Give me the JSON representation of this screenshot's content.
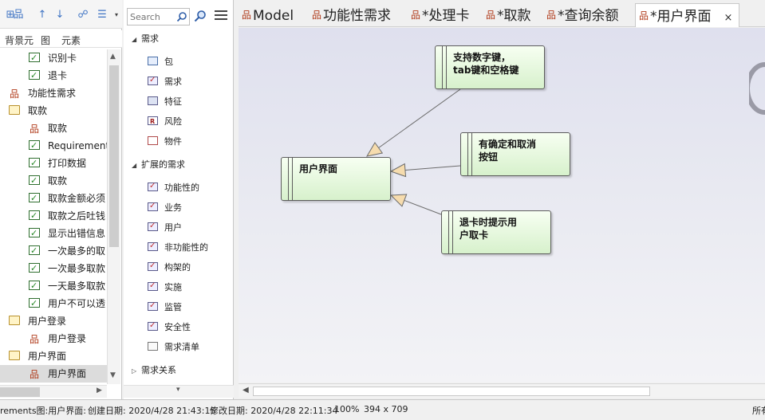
{
  "left_panel": {
    "tabs": [
      "背景元",
      "图",
      "元素"
    ],
    "tree": [
      {
        "label": "识别卡",
        "icon": "requirement-check-icon",
        "indent": 2
      },
      {
        "label": "退卡",
        "icon": "requirement-check-icon",
        "indent": 2
      },
      {
        "label": "功能性需求",
        "icon": "diagram-icon",
        "indent": 1
      },
      {
        "label": "取款",
        "icon": "folder-icon",
        "indent": 1
      },
      {
        "label": "取款",
        "icon": "diagram-icon",
        "indent": 2
      },
      {
        "label": "Requirement",
        "icon": "requirement-check-icon",
        "indent": 2
      },
      {
        "label": "打印数据",
        "icon": "requirement-check-icon",
        "indent": 2
      },
      {
        "label": "取款",
        "icon": "requirement-check-icon",
        "indent": 2
      },
      {
        "label": "取款金额必须",
        "icon": "requirement-check-icon",
        "indent": 2
      },
      {
        "label": "取款之后吐钱",
        "icon": "requirement-check-icon",
        "indent": 2
      },
      {
        "label": "显示出错信息",
        "icon": "requirement-check-icon",
        "indent": 2
      },
      {
        "label": "一次最多的取",
        "icon": "requirement-check-icon",
        "indent": 2
      },
      {
        "label": "一次最多取款",
        "icon": "requirement-check-icon",
        "indent": 2
      },
      {
        "label": "一天最多取款",
        "icon": "requirement-check-icon",
        "indent": 2
      },
      {
        "label": "用户不可以透",
        "icon": "requirement-check-icon",
        "indent": 2
      },
      {
        "label": "用户登录",
        "icon": "folder-icon",
        "indent": 1
      },
      {
        "label": "用户登录",
        "icon": "diagram-icon",
        "indent": 2
      },
      {
        "label": "用户界面",
        "icon": "folder-icon",
        "indent": 1
      },
      {
        "label": "用户界面",
        "icon": "diagram-icon",
        "indent": 2,
        "selected": true
      }
    ]
  },
  "toolbox": {
    "search_placeholder": "Search",
    "sections": [
      {
        "title": "需求",
        "expanded": true,
        "items": [
          {
            "label": "包",
            "icon": "package-icon"
          },
          {
            "label": "需求",
            "icon": "requirement-icon"
          },
          {
            "label": "特征",
            "icon": "feature-icon"
          },
          {
            "label": "风险",
            "icon": "risk-icon"
          },
          {
            "label": "物件",
            "icon": "object-icon"
          }
        ]
      },
      {
        "title": "扩展的需求",
        "expanded": true,
        "items": [
          {
            "label": "功能性的",
            "icon": "requirement-icon"
          },
          {
            "label": "业务",
            "icon": "requirement-icon"
          },
          {
            "label": "用户",
            "icon": "requirement-icon"
          },
          {
            "label": "非功能性的",
            "icon": "requirement-icon"
          },
          {
            "label": "构架的",
            "icon": "requirement-icon"
          },
          {
            "label": "实施",
            "icon": "requirement-icon"
          },
          {
            "label": "监管",
            "icon": "requirement-icon"
          },
          {
            "label": "安全性",
            "icon": "requirement-icon"
          },
          {
            "label": "需求清单",
            "icon": "document-icon"
          }
        ]
      },
      {
        "title": "需求关系",
        "expanded": false,
        "items": []
      }
    ]
  },
  "diagram_tabs": [
    {
      "label": "Model",
      "active": false
    },
    {
      "label": "功能性需求",
      "active": false
    },
    {
      "label": "*处理卡",
      "active": false
    },
    {
      "label": "*取款",
      "active": false
    },
    {
      "label": "*查询余额",
      "active": false
    },
    {
      "label": "*用户界面",
      "active": true,
      "close_label": "×"
    }
  ],
  "diagram": {
    "nodes": [
      {
        "id": "ui",
        "label": "用户界面"
      },
      {
        "id": "keys",
        "label": "支持数字键，\ntab键和空格键"
      },
      {
        "id": "buttons",
        "label": "有确定和取消\n按钮"
      },
      {
        "id": "eject",
        "label": "退卡时提示用\n户取卡"
      }
    ],
    "edges": [
      {
        "from": "keys",
        "to": "ui"
      },
      {
        "from": "buttons",
        "to": "ui"
      },
      {
        "from": "eject",
        "to": "ui"
      }
    ]
  },
  "status_bar": {
    "diagram_name": "rements图:用户界面:",
    "created": "创建日期: 2020/4/28 21:43:15",
    "modified": "修改日期: 2020/4/28 22:11:34",
    "zoom": "100%",
    "size": "394 x 709",
    "right_text": "所有"
  },
  "colors": {
    "node_fill_top": "#f7fff2",
    "node_fill_bottom": "#d7f1cc",
    "canvas_top": "#dfe0ee",
    "toolbar_blue": "#3f74c4"
  }
}
